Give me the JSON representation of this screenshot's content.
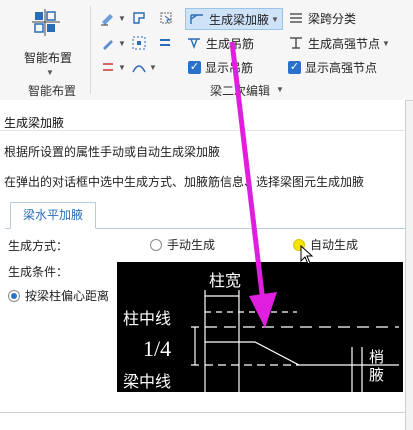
{
  "ribbon": {
    "big_button_label": "智能布置",
    "group_left_label": "智能布置",
    "group_beam_label": "梁二次编辑",
    "gen_haunch": "生成梁加腋",
    "beam_span_class": "梁跨分类",
    "gen_hanger": "生成吊筋",
    "gen_high_node": "生成高强节点",
    "show_hanger": "显示吊筋",
    "show_high_node": "显示高强节点"
  },
  "tooltip": {
    "title": "生成梁加腋",
    "desc1": "根据所设置的属性手动或自动生成梁加腋",
    "desc2": "在弹出的对话框中选中生成方式、加腋筋信息、选择梁图元生成加腋"
  },
  "dialog": {
    "tab": "梁水平加腋",
    "gen_mode_label": "生成方式：",
    "manual": "手动生成",
    "auto": "自动生成",
    "gen_condition_label": "生成条件：",
    "cond_option": "按梁柱偏心距离"
  },
  "diagram": {
    "col_width": "柱宽",
    "col_centerline": "柱中线",
    "fraction": "1/4",
    "beam_centerline": "梁中线",
    "haunch_label": "梁腋",
    "side_text_1": "梢",
    "side_text_2": "腋"
  },
  "colors": {
    "accent": "#2b71c9",
    "arrow": "#e01ee0",
    "highlight": "#f4e300"
  }
}
